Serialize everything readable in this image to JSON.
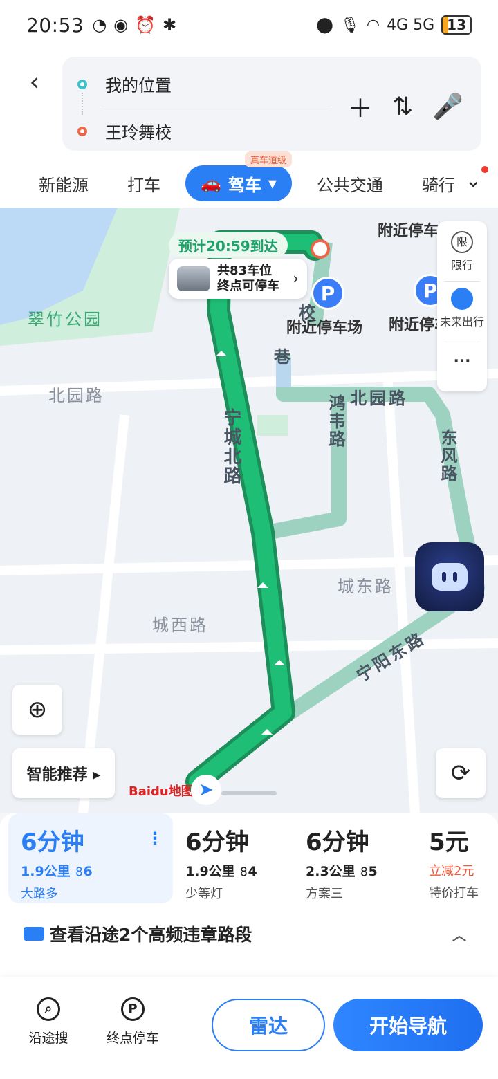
{
  "status": {
    "time": "20:53",
    "battery": "13",
    "network": "4G 5G"
  },
  "route": {
    "start": "我的位置",
    "end": "王玲舞校"
  },
  "modes": [
    {
      "label": "新能源"
    },
    {
      "label": "打车"
    },
    {
      "label": "驾车",
      "badge": "真车道级"
    },
    {
      "label": "公共交通"
    },
    {
      "label": "骑行"
    }
  ],
  "map": {
    "eta": "预计20:59到达",
    "parking_card": {
      "line1": "共83车位",
      "line2": "终点可停车"
    },
    "park_labels": [
      "附近停车场",
      "附近停车"
    ],
    "park_top_label": "附近停车",
    "poi": "翠竹公园",
    "roads": [
      "北园路",
      "宁城北路",
      "鸿韦路",
      "北园路",
      "东风路",
      "城东路",
      "城西路",
      "宁阳东路",
      "巷",
      "校"
    ],
    "side_panel": {
      "restriction": "限行",
      "restriction_icon": "限",
      "future": "未来出行",
      "more": "···"
    },
    "smart_recommend": "智能推荐 ▸",
    "logo": "Baidu地图"
  },
  "routes": [
    {
      "time": "6分钟",
      "distance": "1.9公里",
      "lights": "6",
      "tag": "大路多",
      "selected": true
    },
    {
      "time": "6分钟",
      "distance": "1.9公里",
      "lights": "4",
      "tag": "少等灯"
    },
    {
      "time": "6分钟",
      "distance": "2.3公里",
      "lights": "5",
      "tag": "方案三"
    },
    {
      "time": "5元",
      "discount": "立减2元",
      "tag": "特价打车"
    }
  ],
  "violation": "查看沿途2个高频违章路段",
  "bottom": {
    "along_search": "沿途搜",
    "dest_parking": "终点停车",
    "radar": "雷达",
    "navigate": "开始导航"
  }
}
